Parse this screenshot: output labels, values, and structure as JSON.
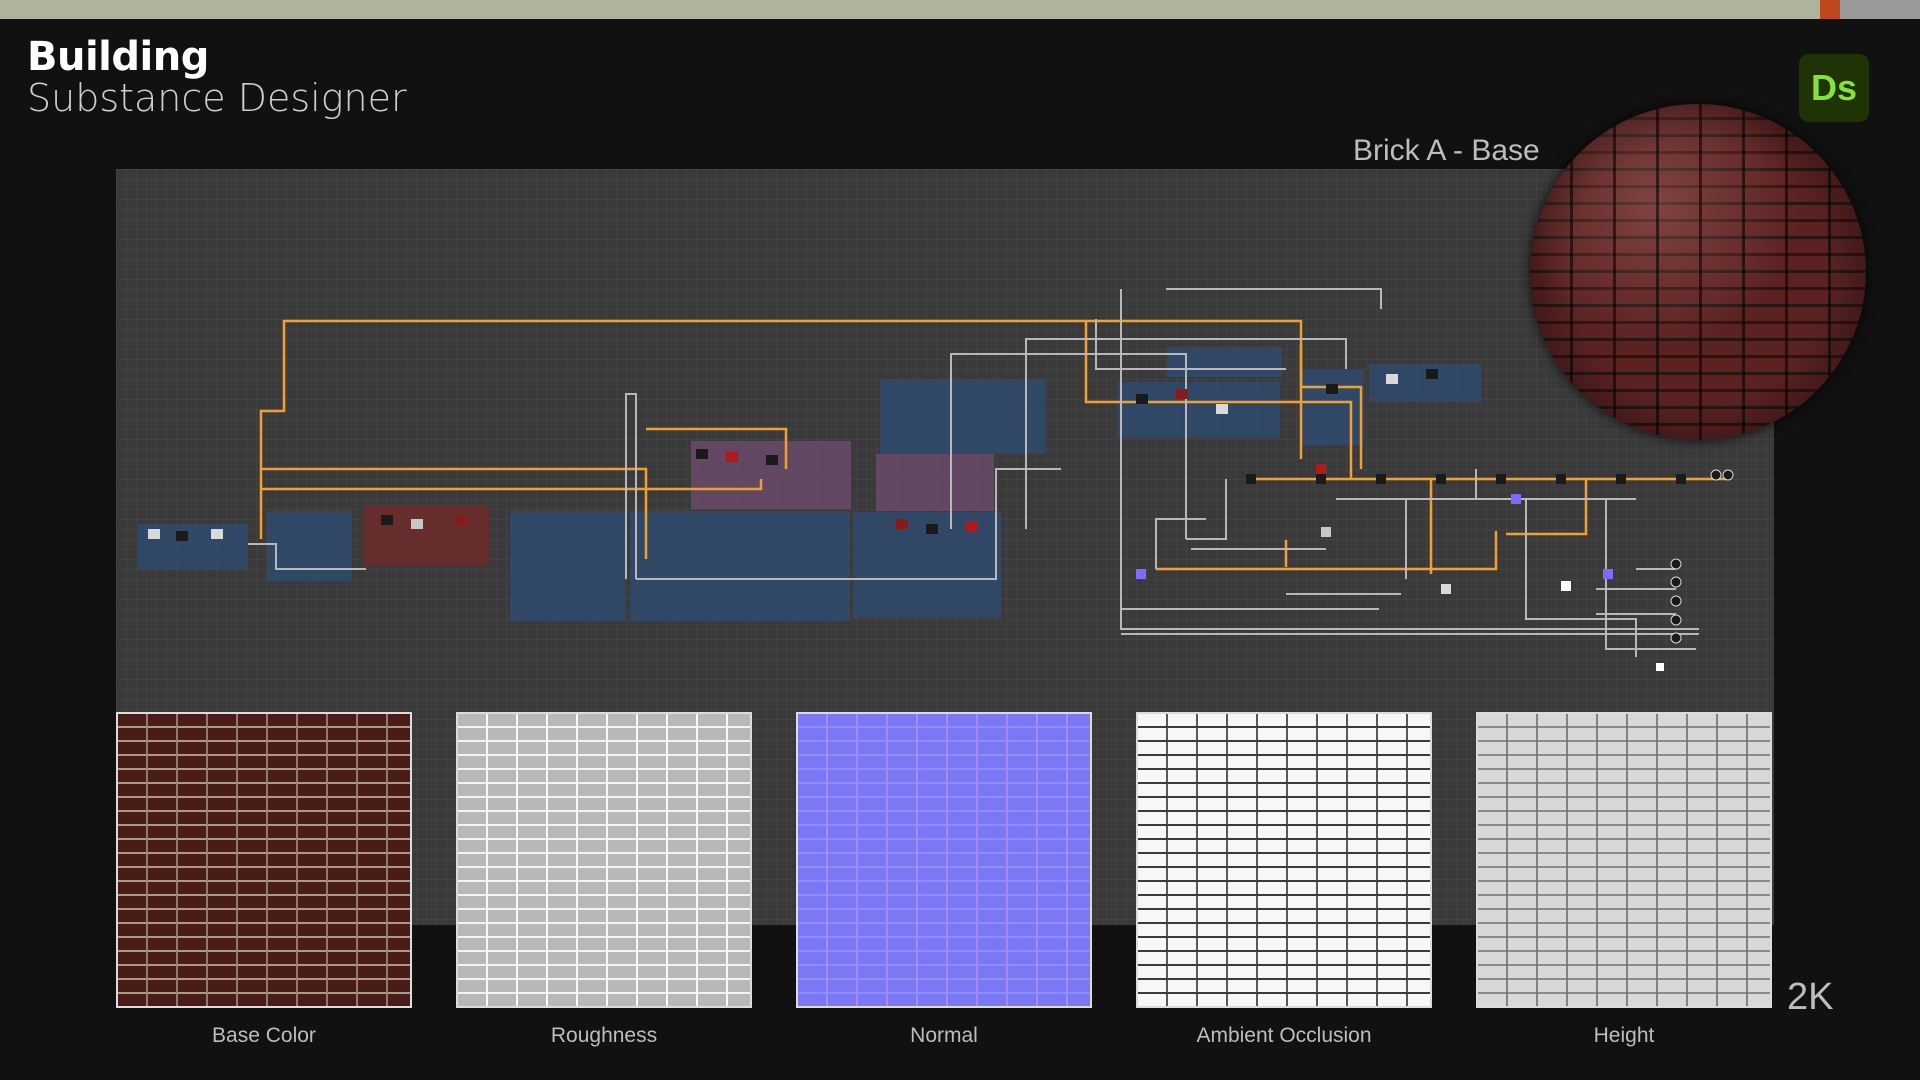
{
  "header": {
    "title": "Building",
    "subtitle": "Substance Designer",
    "app_logo": "Ds"
  },
  "material": {
    "name": "Brick A - Base",
    "resolution": "2K"
  },
  "outputs": [
    {
      "label": "Base Color"
    },
    {
      "label": "Roughness"
    },
    {
      "label": "Normal"
    },
    {
      "label": "Ambient Occlusion"
    },
    {
      "label": "Height"
    }
  ],
  "colors": {
    "background": "#111111",
    "topbar": "#adb39c",
    "logo_bg": "#1e3405",
    "logo_text": "#88e03a",
    "frame_blue": "#2f4b6e",
    "frame_red": "#6e2b2b",
    "frame_pink": "#6a4a6a",
    "wire_orange": "#f0a030",
    "wire_grey": "#b8b8b8"
  }
}
